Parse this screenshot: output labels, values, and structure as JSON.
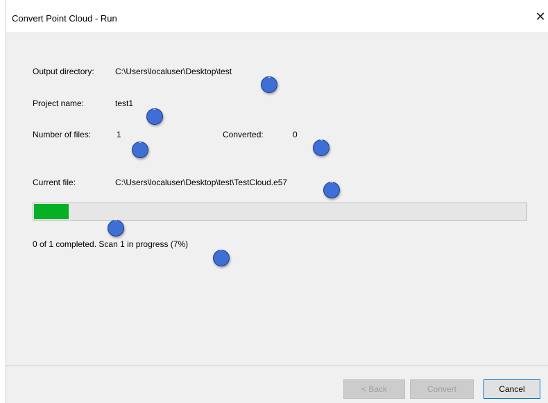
{
  "window": {
    "title": "Convert Point Cloud - Run",
    "close_glyph": "✕"
  },
  "fields": {
    "output_directory": {
      "label": "Output directory:",
      "value": "C:\\Users\\localuser\\Desktop\\test"
    },
    "project_name": {
      "label": "Project name:",
      "value": "test1"
    },
    "number_of_files": {
      "label": "Number of files:",
      "value": "1"
    },
    "converted": {
      "label": "Converted:",
      "value": "0"
    },
    "current_file": {
      "label": "Current file:",
      "value": "C:\\Users\\localuser\\Desktop\\test\\TestCloud.e57"
    }
  },
  "progress": {
    "percent": 7,
    "fill_color": "#06b025"
  },
  "status_text": "0 of 1 completed. Scan 1 in progress (7%)",
  "buttons": {
    "back": "< Back",
    "convert": "Convert",
    "cancel": "Cancel"
  },
  "markers": [
    "1",
    "2",
    "3",
    "4",
    "5",
    "6",
    "7"
  ]
}
